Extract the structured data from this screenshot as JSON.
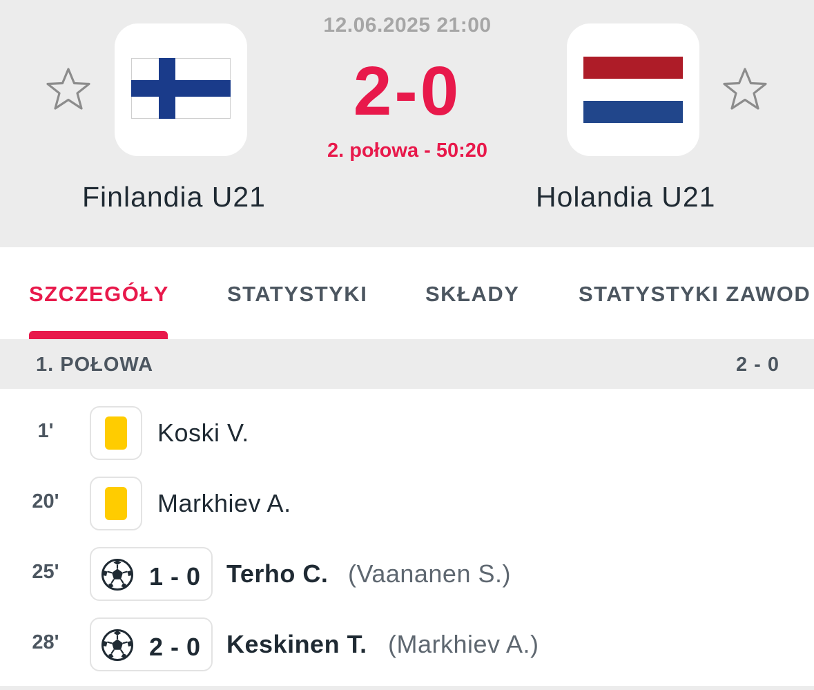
{
  "match": {
    "datetime": "12.06.2025 21:00",
    "score": "2-0",
    "status": "2. połowa - 50:20",
    "home": {
      "name": "Finlandia U21",
      "flag_icon": "finland-flag-icon",
      "flag_colors": {
        "field": "#ffffff",
        "cross": "#1a3b8a"
      }
    },
    "away": {
      "name": "Holandia U21",
      "flag_icon": "netherlands-flag-icon",
      "flag_colors": {
        "top": "#ae1c28",
        "middle": "#ffffff",
        "bottom": "#21468b"
      }
    },
    "favorite_icon": "star-outline-icon"
  },
  "tabs": [
    {
      "label": "SZCZEGÓŁY",
      "active": true
    },
    {
      "label": "STATYSTYKI",
      "active": false
    },
    {
      "label": "SKŁADY",
      "active": false
    },
    {
      "label": "STATYSTYKI ZAWOD",
      "active": false
    }
  ],
  "section": {
    "title": "1. POŁOWA",
    "score": "2 - 0"
  },
  "events": [
    {
      "minute": "1'",
      "type": "yellow-card",
      "icon": "yellow-card-icon",
      "player": "Koski V."
    },
    {
      "minute": "20'",
      "type": "yellow-card",
      "icon": "yellow-card-icon",
      "player": "Markhiev A."
    },
    {
      "minute": "25'",
      "type": "goal",
      "icon": "soccer-ball-icon",
      "score": "1 - 0",
      "player": "Terho C.",
      "assist": "(Vaananen S.)"
    },
    {
      "minute": "28'",
      "type": "goal",
      "icon": "soccer-ball-icon",
      "score": "2 - 0",
      "player": "Keskinen T.",
      "assist": "(Markhiev A.)"
    }
  ],
  "colors": {
    "accent": "#e8194b",
    "header_bg": "#ececec",
    "yellow_card": "#ffcc00",
    "text": "#1f2a33",
    "muted": "#4c5660"
  }
}
